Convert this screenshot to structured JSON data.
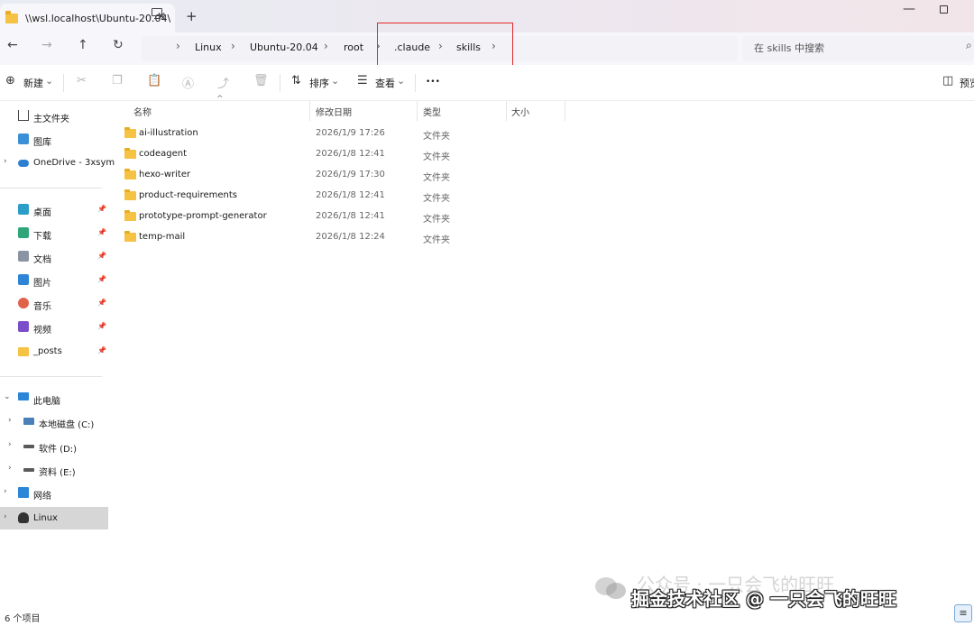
{
  "tab": {
    "title": "\\\\wsl.localhost\\Ubuntu-20.04\\",
    "close": "✕",
    "new_tab": "+"
  },
  "window": {
    "minimize": "—"
  },
  "nav": {
    "back": "←",
    "forward": "→",
    "up": "↑",
    "refresh": "↻",
    "sep": "›"
  },
  "breadcrumb": [
    "Linux",
    "Ubuntu-20.04",
    "root",
    ".claude",
    "skills"
  ],
  "search": {
    "placeholder": "在 skills 中搜索",
    "icon": "⌕"
  },
  "toolbar": {
    "new_label": "新建",
    "sort_label": "排序",
    "view_label": "查看",
    "more": "•••",
    "preview_label": "预览",
    "dropdown": "⌄",
    "icons": {
      "cut": "✂",
      "copy": "❐",
      "paste": "📋",
      "rename": "Ⓐ",
      "share": "⤴",
      "delete": "🗑"
    }
  },
  "columns": {
    "name": "名称",
    "modified": "修改日期",
    "type": "类型",
    "size": "大小",
    "sort_arrow": "^"
  },
  "files": [
    {
      "name": "ai-illustration",
      "date": "2026/1/9 17:26",
      "type": "文件夹"
    },
    {
      "name": "codeagent",
      "date": "2026/1/8 12:41",
      "type": "文件夹"
    },
    {
      "name": "hexo-writer",
      "date": "2026/1/9 17:30",
      "type": "文件夹"
    },
    {
      "name": "product-requirements",
      "date": "2026/1/8 12:41",
      "type": "文件夹"
    },
    {
      "name": "prototype-prompt-generator",
      "date": "2026/1/8 12:41",
      "type": "文件夹"
    },
    {
      "name": "temp-mail",
      "date": "2026/1/8 12:24",
      "type": "文件夹"
    }
  ],
  "sidebar": {
    "top": [
      {
        "label": "主文件夹"
      },
      {
        "label": "图库"
      },
      {
        "label": "OneDrive - 3xsym",
        "chev": "›"
      }
    ],
    "quick": [
      {
        "label": "桌面",
        "pin": "📌"
      },
      {
        "label": "下载",
        "pin": "📌"
      },
      {
        "label": "文档",
        "pin": "📌"
      },
      {
        "label": "图片",
        "pin": "📌"
      },
      {
        "label": "音乐",
        "pin": "📌"
      },
      {
        "label": "视频",
        "pin": "📌"
      },
      {
        "label": "_posts",
        "pin": "📌"
      }
    ],
    "this_pc": {
      "label": "此电脑",
      "chev": "⌄"
    },
    "drives": [
      {
        "label": "本地磁盘 (C:)",
        "chev": "›"
      },
      {
        "label": "软件 (D:)",
        "chev": "›"
      },
      {
        "label": "资料 (E:)",
        "chev": "›"
      }
    ],
    "network": {
      "label": "网络",
      "chev": "›"
    },
    "linux": {
      "label": "Linux",
      "chev": "›"
    }
  },
  "status": {
    "count": "6 个项目",
    "view_icon": "≡"
  },
  "watermark": {
    "line1": "公众号 · 一只会飞的旺旺",
    "line2": "掘金技术社区 @ 一只会飞的旺旺"
  }
}
